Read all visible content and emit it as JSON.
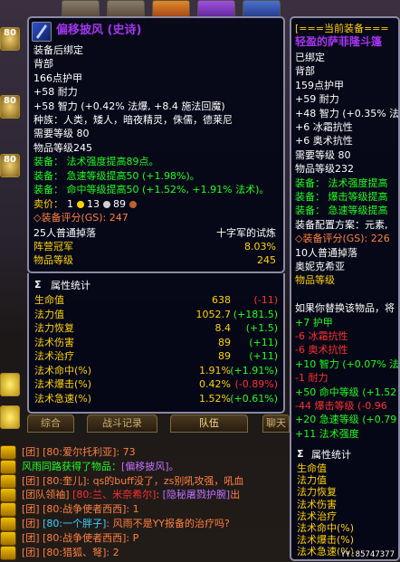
{
  "tip1": {
    "title": "偏移披风 (史诗)",
    "lines": [
      {
        "t": "装备后绑定",
        "c": "w"
      },
      {
        "t": "背部",
        "c": "w"
      },
      {
        "t": "166点护甲",
        "c": "w"
      },
      {
        "t": "+58 耐力",
        "c": "w"
      },
      {
        "t": "+58 智力 (+0.42% 法爆, +8.4 施法回魔)",
        "c": "w"
      },
      {
        "t": "种族：人类，矮人，暗夜精灵，侏儒，德莱尼",
        "c": "w"
      },
      {
        "t": "需要等级 80",
        "c": "w"
      },
      {
        "t": "物品等级245",
        "c": "w"
      },
      {
        "t": "装备：  法术强度提高89点。",
        "c": "g"
      },
      {
        "t": "装备：  急速等级提高50 (+1.98%)。",
        "c": "g"
      },
      {
        "t": "装备：  命中等级提高50 (+1.52%, +1.91% 法术)。",
        "c": "g"
      }
    ],
    "sell_label": "卖价：",
    "sell_g": "1",
    "sell_s": "13",
    "sell_c": "89",
    "gs": "◇装备评分(GS): 247",
    "source_left": "25人普通掉落",
    "source_right": "十字军的试炼",
    "faction_left": "阵营冠军",
    "faction_right": "8.03%",
    "ilvl_left": "物品等级",
    "ilvl_right": "245"
  },
  "stats": {
    "header": "属性统计",
    "rows": [
      {
        "l": "生命值",
        "v": "638",
        "d": "(-11)",
        "dc": "r"
      },
      {
        "l": "法力值",
        "v": "1052.7",
        "d": "(+181.5)",
        "dc": "g"
      },
      {
        "l": "法力恢复",
        "v": "8.4",
        "d": "(+1.5)",
        "dc": "g"
      },
      {
        "l": "法术伤害",
        "v": "89",
        "d": "(+11)",
        "dc": "g"
      },
      {
        "l": "法术治疗",
        "v": "89",
        "d": "(+11)",
        "dc": "g"
      },
      {
        "l": "法术命中(%)",
        "v": "1.91%",
        "d": "(+1.91%)",
        "dc": "g"
      },
      {
        "l": "法术爆击(%)",
        "v": "0.42%",
        "d": "(-0.89%)",
        "dc": "r"
      },
      {
        "l": "法术急速(%)",
        "v": "1.52%",
        "d": "(+0.61%)",
        "dc": "g"
      }
    ]
  },
  "tip2": {
    "header": "[===当前装备===",
    "title": "轻盈的萨菲隆斗篷",
    "lines": [
      {
        "t": "已绑定",
        "c": "w"
      },
      {
        "t": "背部",
        "c": "w"
      },
      {
        "t": "159点护甲",
        "c": "w"
      },
      {
        "t": "+59 耐力",
        "c": "w"
      },
      {
        "t": "+48 智力 (+0.35% 法",
        "c": "w"
      },
      {
        "t": "+6 冰霜抗性",
        "c": "w"
      },
      {
        "t": "+6 奥术抗性",
        "c": "w"
      },
      {
        "t": "需要等级 80",
        "c": "w"
      },
      {
        "t": "物品等级232",
        "c": "w"
      },
      {
        "t": "装备：  法术强度提高",
        "c": "g"
      },
      {
        "t": "装备：  爆击等级提高",
        "c": "g"
      },
      {
        "t": "装备：  急速等级提高",
        "c": "g"
      },
      {
        "t": "装备配置方案：元素,",
        "c": "w"
      },
      {
        "t": "◇装备评分(GS): 226",
        "c": "o"
      },
      {
        "t": "10人普通掉落",
        "c": "w"
      },
      {
        "t": "奥妮克希亚",
        "c": "w"
      },
      {
        "t": "物品等级",
        "c": "y"
      },
      {
        "t": "",
        "c": "w"
      },
      {
        "t": "如果你替换该物品，将",
        "c": "w"
      },
      {
        "t": "+7 护甲",
        "c": "g"
      },
      {
        "t": "-6 冰霜抗性",
        "c": "r"
      },
      {
        "t": "-6 奥术抗性",
        "c": "r"
      },
      {
        "t": "+10 智力 (+0.07% 法",
        "c": "g"
      },
      {
        "t": "-1 耐力",
        "c": "r"
      },
      {
        "t": "+50 命中等级 (+1.52",
        "c": "g"
      },
      {
        "t": "-44 爆击等级 (-0.96",
        "c": "r"
      },
      {
        "t": "+20 急速等级 (+0.79",
        "c": "g"
      },
      {
        "t": "+11 法术强度",
        "c": "g"
      }
    ],
    "stats_header": "属性统计",
    "stats": [
      "生命值",
      "法力值",
      "法力恢复",
      "法术伤害",
      "法术治疗",
      "法术命中(%)",
      "法术爆击(%)",
      "法术急速(%)"
    ]
  },
  "tabs": [
    "综合",
    "战斗记录",
    "队伍",
    "聊天"
  ],
  "chat": [
    {
      "parts": [
        {
          "t": "[团] [80:爱尔托利亚]:  73",
          "c": "o"
        }
      ]
    },
    {
      "parts": [
        {
          "t": "风雨同路获得了物品：",
          "c": "g"
        },
        {
          "t": "[偏移披风]。",
          "c": "p"
        }
      ]
    },
    {
      "parts": [
        {
          "t": "[团] [80:奎儿]:  qs的buff没了，zs别吼攻强，吼血",
          "c": "o"
        }
      ]
    },
    {
      "parts": [
        {
          "t": "[团队领袖] ",
          "c": "o"
        },
        {
          "t": "[80:兰、米奈希尔]",
          "c": "r"
        },
        {
          "t": ":  ",
          "c": "o"
        },
        {
          "t": "[隐秘屠戮护腕]",
          "c": "p"
        },
        {
          "t": "出",
          "c": "o"
        }
      ]
    },
    {
      "parts": [
        {
          "t": "[团] [80:战争使者西西]:  1",
          "c": "o"
        }
      ]
    },
    {
      "parts": [
        {
          "t": "[团] ",
          "c": "o"
        },
        {
          "t": "[80:一个胖子]",
          "c": "c"
        },
        {
          "t": ":  风雨不是YY报备的治疗吗?",
          "c": "o"
        }
      ]
    },
    {
      "parts": [
        {
          "t": "[团] [80:战争使者西西]:  P",
          "c": "o"
        }
      ]
    },
    {
      "parts": [
        {
          "t": "[团] [80:猎狐、弩]:  2",
          "c": "o"
        }
      ]
    }
  ],
  "left_icons": [
    "80",
    "80",
    "80"
  ],
  "watermark": "YY:85747377",
  "colors": {
    "epic": "#a335ee",
    "uncommon": "#1eff1e",
    "gold": "#ffd200",
    "border": "#8a8aa4"
  }
}
